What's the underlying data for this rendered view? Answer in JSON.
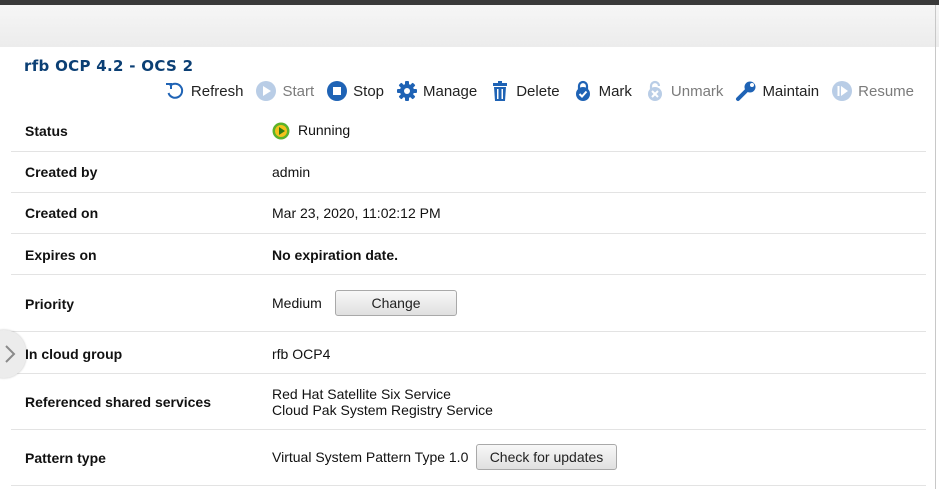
{
  "header": {
    "title": "rfb OCP 4.2 - OCS 2"
  },
  "toolbar": {
    "refresh": "Refresh",
    "start": "Start",
    "stop": "Stop",
    "manage": "Manage",
    "delete": "Delete",
    "mark": "Mark",
    "unmark": "Unmark",
    "maintain": "Maintain",
    "resume": "Resume"
  },
  "details": {
    "status": {
      "label": "Status",
      "value": "Running"
    },
    "created_by": {
      "label": "Created by",
      "value": "admin"
    },
    "created_on": {
      "label": "Created on",
      "value": "Mar 23, 2020, 11:02:12 PM"
    },
    "expires_on": {
      "label": "Expires on",
      "value": "No expiration date."
    },
    "priority": {
      "label": "Priority",
      "value": "Medium",
      "button": "Change"
    },
    "cloud_group": {
      "label": "In cloud group",
      "value": "rfb OCP4"
    },
    "shared_services": {
      "label": "Referenced shared services",
      "items": [
        "Red Hat Satellite Six Service",
        "Cloud Pak System Registry Service"
      ]
    },
    "pattern_type": {
      "label": "Pattern type",
      "value": "Virtual System Pattern Type 1.0",
      "button": "Check for updates"
    }
  },
  "colors": {
    "title": "#0b3f74",
    "link": "#2a6bb5",
    "accent": "#1f63b5",
    "running": "#5bb32b"
  }
}
